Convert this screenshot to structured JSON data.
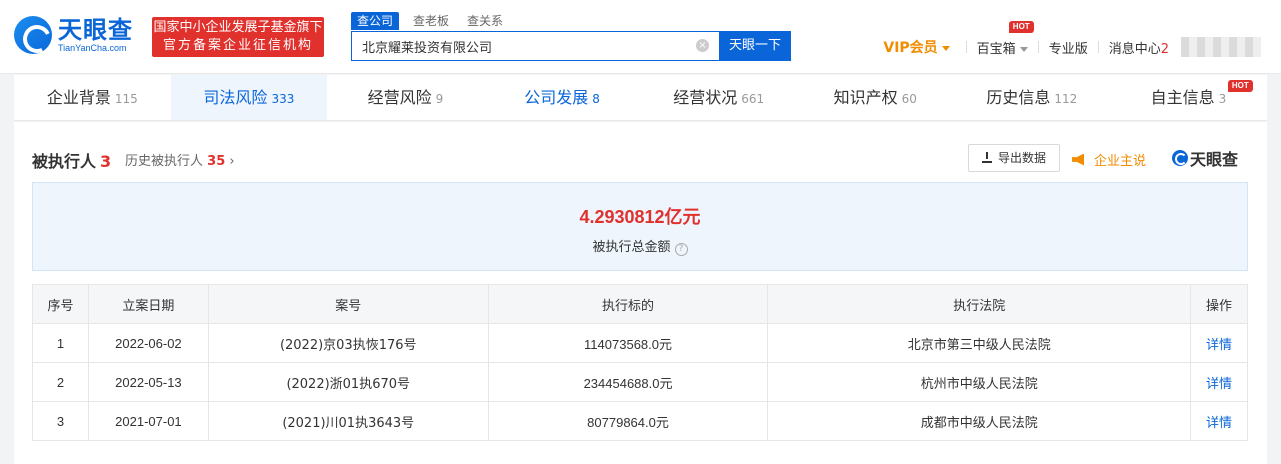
{
  "header": {
    "logo_cn": "天眼查",
    "logo_en": "TianYanCha.com",
    "badge_line1": "国家中小企业发展子基金旗下",
    "badge_line2": "官方备案企业征信机构",
    "search_tabs": [
      "查公司",
      "查老板",
      "查关系"
    ],
    "search_value": "北京耀莱投资有限公司",
    "search_button": "天眼一下",
    "nav": {
      "vip": "VIP会员",
      "treasure": "百宝箱",
      "hot": "HOT",
      "pro": "专业版",
      "messages": "消息中心",
      "message_count": "2"
    }
  },
  "tabs": [
    {
      "label": "企业背景",
      "count": "115"
    },
    {
      "label": "司法风险",
      "count": "333"
    },
    {
      "label": "经营风险",
      "count": "9"
    },
    {
      "label": "公司发展",
      "count": "8"
    },
    {
      "label": "经营状况",
      "count": "661"
    },
    {
      "label": "知识产权",
      "count": "60"
    },
    {
      "label": "历史信息",
      "count": "112"
    },
    {
      "label": "自主信息",
      "count": "3",
      "badge": "HOT"
    }
  ],
  "section": {
    "title": "被执行人",
    "count": "3",
    "history_label": "历史被执行人",
    "history_count": "35",
    "export_label": "导出数据",
    "speak_label": "企业主说",
    "brand": "天眼查",
    "amount": "4.2930812亿元",
    "amount_label": "被执行总金额"
  },
  "table": {
    "headers": [
      "序号",
      "立案日期",
      "案号",
      "执行标的",
      "执行法院",
      "操作"
    ],
    "rows": [
      {
        "no": "1",
        "date": "2022-06-02",
        "case": "(2022)京03执恢176号",
        "amount": "114073568.0元",
        "court": "北京市第三中级人民法院",
        "action": "详情"
      },
      {
        "no": "2",
        "date": "2022-05-13",
        "case": "(2022)浙01执670号",
        "amount": "234454688.0元",
        "court": "杭州市中级人民法院",
        "action": "详情"
      },
      {
        "no": "3",
        "date": "2021-07-01",
        "case": "(2021)川01执3643号",
        "amount": "80779864.0元",
        "court": "成都市中级人民法院",
        "action": "详情"
      }
    ]
  }
}
